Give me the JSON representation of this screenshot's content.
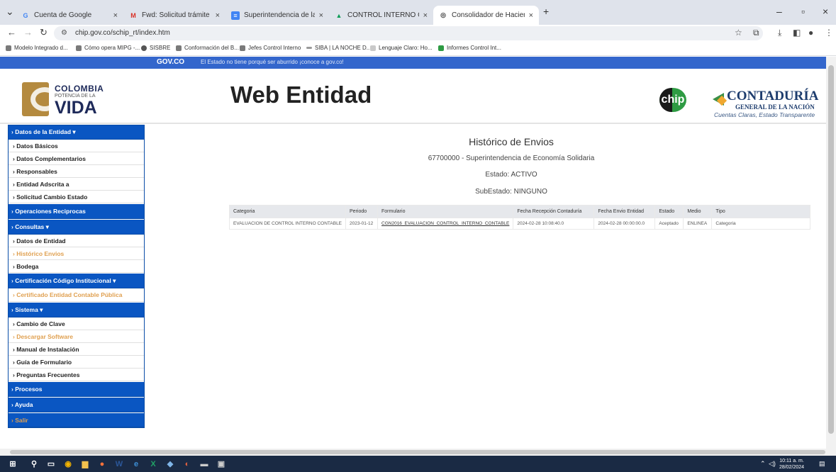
{
  "browser": {
    "tabs": [
      {
        "label": "Cuenta de Google",
        "icon": "google-icon"
      },
      {
        "label": "Fwd: Solicitud trámite paz y sal",
        "icon": "gmail-icon"
      },
      {
        "label": "Superintendencia de la Econom",
        "icon": "docs-icon"
      },
      {
        "label": "CONTROL INTERNO CONTABLE",
        "icon": "drive-icon"
      },
      {
        "label": "Consolidador de Hacienda e Inf",
        "icon": "globe-icon"
      }
    ],
    "url": "chip.gov.co/schip_rt/index.htm",
    "bookmarks": [
      "Modelo Integrado d...",
      "Cómo opera MIPG -...",
      "SISBRE",
      "Conformación del B...",
      "Jefes Control Interno",
      "SIBA | LA NOCHE D...",
      "Lenguaje Claro: Ho...",
      "Informes Control Int..."
    ]
  },
  "govbar": {
    "logo": "GOV.CO",
    "text": "El Estado no tiene porqué ser aburrido ¡conoce a gov.co!"
  },
  "header": {
    "colombia_line1": "COLOMBIA",
    "colombia_line2": "POTENCIA DE LA",
    "colombia_line3": "VIDA",
    "title": "Web Entidad",
    "chip_logo": "chip",
    "cgn_line1": "CONTADURÍA",
    "cgn_line2": "GENERAL DE LA NACIÓN",
    "cgn_line3": "Cuentas Claras, Estado Transparente"
  },
  "sidebar": {
    "items": [
      {
        "label": "› Datos de la Entidad ▾",
        "type": "section"
      },
      {
        "label": "› Datos Básicos",
        "type": "sub"
      },
      {
        "label": "› Datos Complementarios",
        "type": "sub"
      },
      {
        "label": "› Responsables",
        "type": "sub"
      },
      {
        "label": "› Entidad Adscrita a",
        "type": "sub"
      },
      {
        "label": "› Solicitud Cambio Estado",
        "type": "sub"
      },
      {
        "label": "› Operaciones Reciprocas",
        "type": "section"
      },
      {
        "label": "› Consultas ▾",
        "type": "section"
      },
      {
        "label": "› Datos de Entidad",
        "type": "sub"
      },
      {
        "label": "› Histórico Envios",
        "type": "sub-hl"
      },
      {
        "label": "› Bodega",
        "type": "sub"
      },
      {
        "label": "› Certificación Código Institucional ▾",
        "type": "section"
      },
      {
        "label": "› Certificado Entidad Contable Pública",
        "type": "sub-hl"
      },
      {
        "label": "› Sistema ▾",
        "type": "section"
      },
      {
        "label": "› Cambio de Clave",
        "type": "sub"
      },
      {
        "label": "› Descargar Software",
        "type": "sub-hl"
      },
      {
        "label": "› Manual de Instalación",
        "type": "sub"
      },
      {
        "label": "› Guía de Formulario",
        "type": "sub"
      },
      {
        "label": "› Preguntas Frecuentes",
        "type": "sub"
      },
      {
        "label": "› Procesos",
        "type": "section"
      },
      {
        "label": "› Ayuda",
        "type": "section"
      },
      {
        "label": "› Salir",
        "type": "section-hl"
      }
    ]
  },
  "main": {
    "title": "Histórico de Envios",
    "entity": "67700000 - Superintendencia de Economía Solidaria",
    "estado": "Estado: ACTIVO",
    "subestado": "SubEstado: NINGUNO",
    "table": {
      "headers": [
        "Categoria",
        "Periodo",
        "Formulario",
        "Fecha Recepción Contaduría",
        "Fecha Envio Entidad",
        "Estado",
        "Medio",
        "Tipo"
      ],
      "rows": [
        [
          "EVALUACION DE CONTROL INTERNO CONTABLE",
          "2023-01-12",
          "CGN2016_EVALUACION_CONTROL_INTERNO_CONTABLE",
          "2024-02-28 10:08:40.0",
          "2024-02-28 00:00:00.0",
          "Aceptado",
          "ENLINEA",
          "Categoria"
        ]
      ]
    }
  },
  "taskbar": {
    "time": "10:11 a. m.",
    "date": "28/02/2024"
  },
  "colors": {
    "gov_blue": "#3366cc",
    "menu_blue": "#0a56c2",
    "menu_highlight": "#e0a050"
  }
}
